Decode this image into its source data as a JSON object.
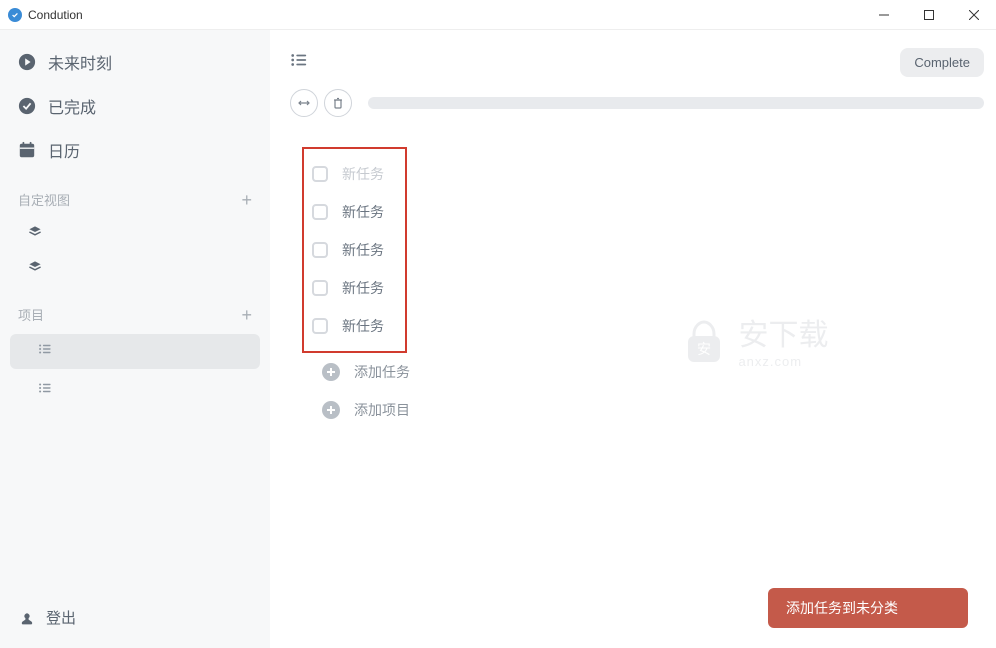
{
  "window": {
    "title": "Condution"
  },
  "sidebar": {
    "nav": [
      {
        "label": "未来时刻",
        "icon": "play"
      },
      {
        "label": "已完成",
        "icon": "check"
      },
      {
        "label": "日历",
        "icon": "calendar"
      }
    ],
    "custom_view_header": "自定视图",
    "projects_header": "项目",
    "logout": "登出"
  },
  "toolbar": {
    "complete": "Complete"
  },
  "tasks": [
    {
      "label": "新任务",
      "faded": true
    },
    {
      "label": "新任务",
      "faded": false
    },
    {
      "label": "新任务",
      "faded": false
    },
    {
      "label": "新任务",
      "faded": false
    },
    {
      "label": "新任务",
      "faded": false
    }
  ],
  "actions": {
    "add_task": "添加任务",
    "add_project": "添加项目"
  },
  "toast": "添加任务到未分类",
  "watermark": {
    "cn": "安下载",
    "en": "anxz.com"
  }
}
